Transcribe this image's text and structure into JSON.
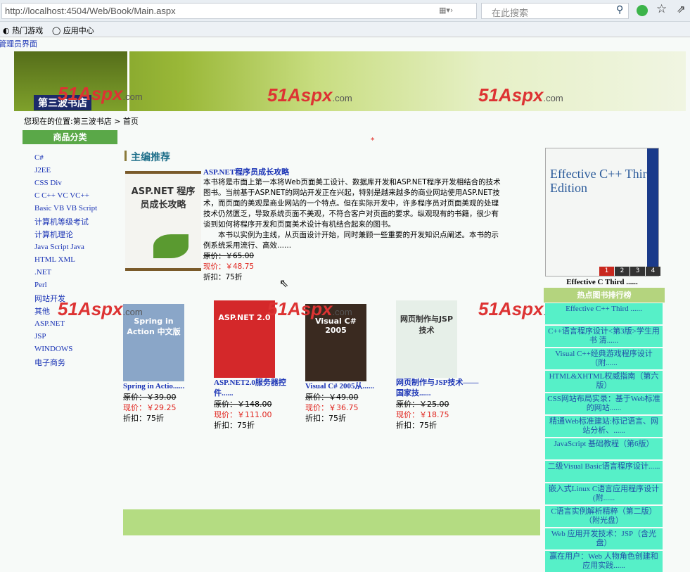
{
  "browser": {
    "url": "http://localhost:4504/Web/Book/Main.aspx",
    "search_placeholder": "在此搜索",
    "bookmarks": [
      "热门游戏",
      "应用中心"
    ]
  },
  "admin_link": "管理员界面",
  "banner": {
    "logo_text": "第三波书店",
    "watermark": "51Aspx",
    "watermark_suffix": ".com"
  },
  "breadcrumb": "您现在的位置:第三波书店 > 首页",
  "sidebar": {
    "title": "商品分类",
    "items": [
      "C#",
      "J2EE",
      "CSS Div",
      "C C++ VC VC++",
      "Basic VB VB Script",
      "计算机等级考试",
      "计算机理论",
      "Java Script Java",
      "HTML XML",
      ".NET",
      "Perl",
      "网站开发",
      "其他",
      "ASP.NET",
      "JSP",
      "WINDOWS",
      "电子商务"
    ]
  },
  "featured": {
    "section_title": "主编推荐",
    "title": "ASP.NET程序员成长攻略",
    "cover_text": "ASP.NET 程序员成长攻略",
    "description": "本书将是市面上第一本将Web页面美工设计、数据库开发和ASP.NET程序开发相结合的技术图书。当前基于ASP.NET的网站开发正在兴起，特别是越来越多的商业网站使用ASP.NET技术，而页面的美观是商业网站的一个特点。但在实际开发中，许多程序员对页面美观的处理技术仍然匮乏，导致系统页面不美观，不符合客户对页面的要求。纵观现有的书籍，很少有谈到如何将程序开发和页面美术设计有机结合起来的图书。",
    "description2": "本书以实例为主线，从页面设计开始，同时兼顾一些重要的开发知识点阐述。本书的示例系统采用流行、高效......",
    "orig": "原价：￥65.00",
    "now": "现价：￥48.75",
    "discount": "折扣：75折"
  },
  "books": [
    {
      "title": "Spring in Actio......",
      "orig": "原价：￥39.00",
      "now": "现价：￥29.25",
      "discount": "折扣：75折",
      "cover": "Spring in Action 中文版",
      "color": "#8aa6c8"
    },
    {
      "title": "ASP.NET2.0服务器控件......",
      "orig": "原价：￥148.00",
      "now": "现价：￥111.00",
      "discount": "折扣：75折",
      "cover": "ASP.NET 2.0",
      "color": "#d4282a"
    },
    {
      "title": "Visual C# 2005从......",
      "orig": "原价：￥49.00",
      "now": "现价：￥36.75",
      "discount": "折扣：75折",
      "cover": "Visual C# 2005",
      "color": "#3a2a20"
    },
    {
      "title": "网页制作与JSP技术——国家技......",
      "orig": "原价：￥25.00",
      "now": "现价：￥18.75",
      "discount": "折扣：75折",
      "cover": "网页制作与JSP技术",
      "color": "#e6efe8"
    }
  ],
  "carousel": {
    "caption": "Effective C   Third ......",
    "cover": "Effective C++ Third Edition",
    "pages": [
      "1",
      "2",
      "3",
      "4"
    ]
  },
  "ranking": {
    "title": "热点图书排行榜",
    "items": [
      "Effective C++ Third ......",
      "C++语言程序设计<第3版>学生用书 清......",
      "Visual C++经典游戏程序设计（附......",
      "HTML&XHTML权威指南（第六版）",
      "CSS网站布局实录：基于Web标准的网站......",
      "精通Web标准建站:标记语言、网站分析、......",
      "JavaScript 基础教程（第6版）",
      "二级Visual Basic语言程序设计......",
      "嵌入式Linux C语言应用程序设计(附......",
      "C语言实例解析精粹（第二版）（附光盘）",
      "Web 应用开发技术：JSP（含光盘）",
      "赢在用户：Web 人物角色创建和应用实践......"
    ]
  },
  "colors": {
    "accent_green": "#5aa848",
    "rank_bg": "#56f0c8",
    "price_red": "#e0231c",
    "link_blue": "#1a33b5"
  }
}
